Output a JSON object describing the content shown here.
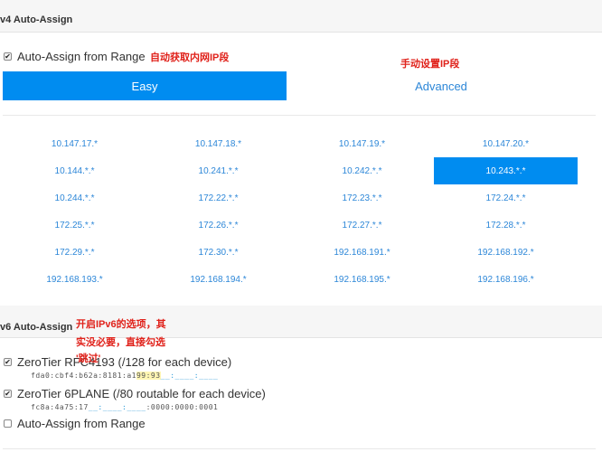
{
  "ipv4": {
    "section_title": "v4 Auto-Assign",
    "auto_assign_label": "Auto-Assign from Range",
    "auto_assign_checked": true,
    "easy_label": "Easy",
    "advanced_label": "Advanced",
    "annotation_auto": "自动获取内网IP段",
    "annotation_manual": "手动设置IP段",
    "selected_range": "10.243.*.*",
    "ranges": [
      "10.147.17.*",
      "10.147.18.*",
      "10.147.19.*",
      "10.147.20.*",
      "10.144.*.*",
      "10.241.*.*",
      "10.242.*.*",
      "10.243.*.*",
      "10.244.*.*",
      "172.22.*.*",
      "172.23.*.*",
      "172.24.*.*",
      "172.25.*.*",
      "172.26.*.*",
      "172.27.*.*",
      "172.28.*.*",
      "172.29.*.*",
      "172.30.*.*",
      "192.168.191.*",
      "192.168.192.*",
      "192.168.193.*",
      "192.168.194.*",
      "192.168.195.*",
      "192.168.196.*"
    ]
  },
  "ipv6": {
    "section_title": "v6 Auto-Assign",
    "annotation_lines": [
      "开启IPv6的选项，其",
      "实没必要，直接勾选",
      "'跳过'"
    ],
    "rfc4193": {
      "label": "ZeroTier RFC4193 (/128 for each device)",
      "checked": true,
      "address_prefix": "fda0:cbf4:b62a:8181:a1",
      "address_mid": "99:93",
      "address_blanks": "__:____:____"
    },
    "sixplane": {
      "label": "ZeroTier 6PLANE (/80 routable for each device)",
      "checked": true,
      "address_prefix": "fc8a:4a75:17",
      "address_blanks": "__:____:____",
      "address_suffix": ":0000:0000:0001"
    },
    "auto_range": {
      "label": "Auto-Assign from Range",
      "checked": false
    }
  }
}
